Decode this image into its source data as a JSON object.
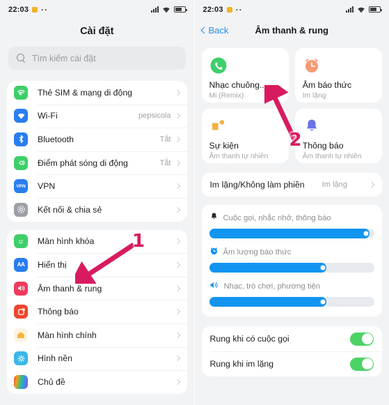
{
  "left": {
    "statusbar": {
      "time": "22:03",
      "dots": "··",
      "icons": [
        "signal-icon",
        "wifi-icon",
        "battery-icon"
      ]
    },
    "title": "Cài đặt",
    "search": {
      "placeholder": "Tìm kiếm cài đặt",
      "icon": "search-icon"
    },
    "group1": [
      {
        "label": "Thẻ SIM & mạng di động",
        "value": "",
        "icon": "sim-network-icon",
        "color": "#3ecf6a",
        "glyph": "((·))"
      },
      {
        "label": "Wi-Fi",
        "value": "pepsicola",
        "icon": "wifi-icon",
        "color": "#2a7df0",
        "glyph": "wifi"
      },
      {
        "label": "Bluetooth",
        "value": "Tắt",
        "icon": "bluetooth-icon",
        "color": "#2a7df0",
        "glyph": "bt"
      },
      {
        "label": "Điểm phát sóng di động",
        "value": "Tắt",
        "icon": "hotspot-icon",
        "color": "#3ecf6a",
        "glyph": "hs"
      },
      {
        "label": "VPN",
        "value": "",
        "icon": "vpn-icon",
        "color": "#2a7df0",
        "glyph": "VPN"
      },
      {
        "label": "Kết nối & chia sẻ",
        "value": "",
        "icon": "connection-share-icon",
        "color": "#9ca0a5",
        "glyph": "gear"
      }
    ],
    "group2": [
      {
        "label": "Màn hình khóa",
        "value": "",
        "icon": "lock-screen-icon",
        "color": "#3ecf6a",
        "glyph": "face"
      },
      {
        "label": "Hiển thị",
        "value": "",
        "icon": "display-icon",
        "color": "#2a7df0",
        "glyph": "AA"
      },
      {
        "label": "Âm thanh & rung",
        "value": "",
        "icon": "sound-vibration-icon",
        "color": "#ef3b5b",
        "glyph": "spk"
      },
      {
        "label": "Thông báo",
        "value": "",
        "icon": "notification-icon",
        "color": "#f0462e",
        "glyph": "note"
      },
      {
        "label": "Màn hình chính",
        "value": "",
        "icon": "home-screen-icon",
        "color": "#f6b93b",
        "glyph": "home"
      },
      {
        "label": "Hình nền",
        "value": "",
        "icon": "wallpaper-icon",
        "color": "#3ab7e8",
        "glyph": "flower"
      },
      {
        "label": "Chủ đề",
        "value": "",
        "icon": "theme-icon",
        "color": "#e94f8a",
        "glyph": "theme"
      }
    ]
  },
  "right": {
    "statusbar": {
      "time": "22:03",
      "dots": "··",
      "icons": [
        "signal-icon",
        "wifi-icon",
        "battery-icon"
      ]
    },
    "back_label": "Back",
    "nav_title": "Âm thanh & rung",
    "cards": [
      {
        "title": "Nhạc chuông...",
        "subtitle": "Mi (Remix)",
        "icon": "phone-ringtone-icon",
        "color": "#3ecf6a"
      },
      {
        "title": "Âm báo thức",
        "subtitle": "Im lặng",
        "icon": "alarm-clock-icon",
        "color": "#f79a73"
      },
      {
        "title": "Sự kiện",
        "subtitle": "Âm thanh tự nhiên",
        "icon": "event-icon",
        "color": "#f3b03f"
      },
      {
        "title": "Thông báo",
        "subtitle": "Âm thanh tự nhiên",
        "icon": "bell-notification-icon",
        "color": "#6b72e8"
      }
    ],
    "dnd": {
      "label": "Im lặng/Không làm phiền",
      "value": "Im lặng"
    },
    "sliders": [
      {
        "label": "Cuộc gọi, nhắc nhở, thông báo",
        "icon": "bell-icon",
        "percent": 97
      },
      {
        "label": "Âm lượng báo thức",
        "icon": "alarm-icon",
        "percent": 71
      },
      {
        "label": "Nhạc, trò chơi, phương tiện",
        "icon": "speaker-icon",
        "percent": 71
      }
    ],
    "toggles": [
      {
        "label": "Rung khi có cuộc gọi",
        "state": "on"
      },
      {
        "label": "Rung khi im lặng",
        "state": "on"
      }
    ]
  },
  "annotations": [
    {
      "number": "1",
      "color": "#d81b60"
    },
    {
      "number": "2",
      "color": "#d81b60"
    }
  ]
}
